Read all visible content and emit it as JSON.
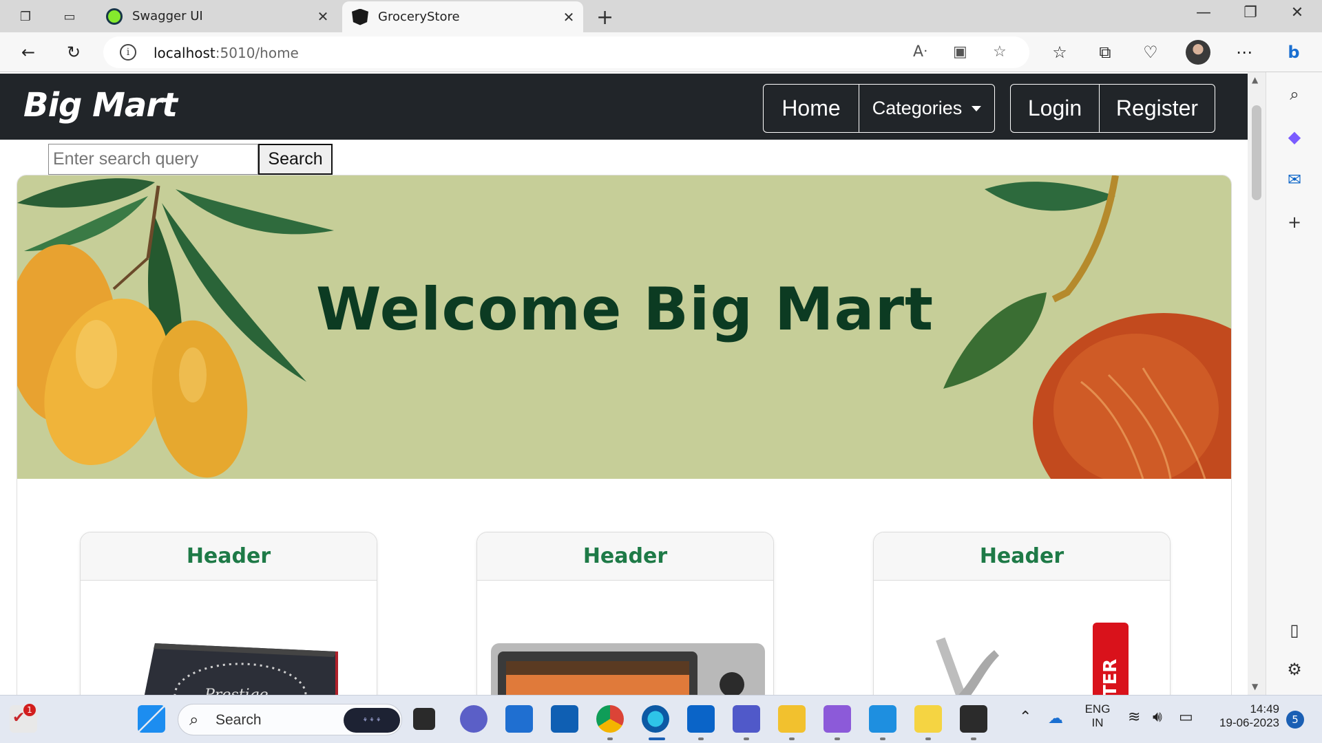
{
  "browser": {
    "tabs": [
      {
        "label": "Swagger UI",
        "active": false
      },
      {
        "label": "GroceryStore",
        "active": true
      }
    ],
    "url_host": "localhost",
    "url_path": ":5010/home"
  },
  "site": {
    "brand": "Big Mart",
    "nav": {
      "home": "Home",
      "categories": "Categories",
      "login": "Login",
      "register": "Register"
    },
    "search": {
      "placeholder": "Enter search query",
      "button": "Search"
    },
    "banner_title": "Welcome Big Mart",
    "products": [
      {
        "header": "Header",
        "image": "induction-cooktop"
      },
      {
        "header": "Header",
        "image": "oven-toaster-grill"
      },
      {
        "header": "Header",
        "image": "mixer-blade"
      }
    ]
  },
  "taskbar": {
    "search_label": "Search",
    "language": "ENG",
    "region": "IN",
    "time": "14:49",
    "date": "19-06-2023",
    "notifications": "5",
    "app_badge": "1"
  },
  "colors": {
    "site_nav_bg": "#212529",
    "banner_bg": "#c6ce98",
    "banner_title": "#0c3b22",
    "card_header": "#1e7a47"
  }
}
